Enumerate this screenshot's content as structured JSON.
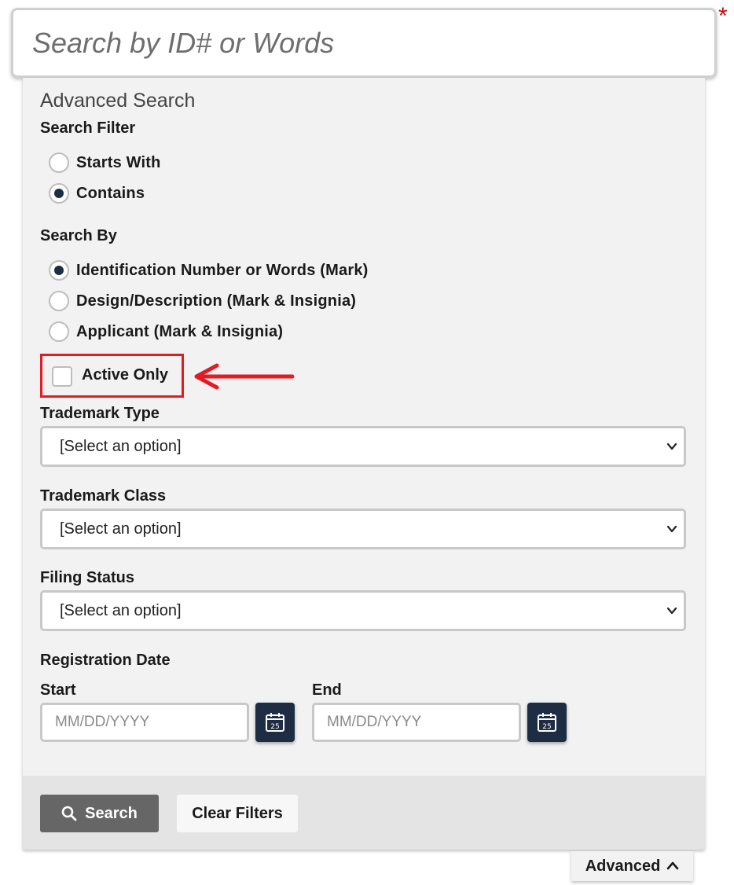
{
  "search": {
    "placeholder": "Search by ID# or Words",
    "required_marker": "*"
  },
  "advanced_title": "Advanced Search",
  "search_filter": {
    "label": "Search Filter",
    "options": [
      {
        "label": "Starts With",
        "checked": false
      },
      {
        "label": "Contains",
        "checked": true
      }
    ]
  },
  "search_by": {
    "label": "Search By",
    "options": [
      {
        "label": "Identification Number or Words (Mark)",
        "checked": true
      },
      {
        "label": "Design/Description (Mark & Insignia)",
        "checked": false
      },
      {
        "label": "Applicant (Mark & Insignia)",
        "checked": false
      }
    ]
  },
  "active_only": {
    "label": "Active Only",
    "checked": false
  },
  "trademark_type": {
    "label": "Trademark Type",
    "value": "[Select an option]"
  },
  "trademark_class": {
    "label": "Trademark Class",
    "value": "[Select an option]"
  },
  "filing_status": {
    "label": "Filing Status",
    "value": "[Select an option]"
  },
  "registration_date": {
    "label": "Registration Date",
    "start": {
      "label": "Start",
      "placeholder": "MM/DD/YYYY"
    },
    "end": {
      "label": "End",
      "placeholder": "MM/DD/YYYY"
    },
    "calendar_day": "25"
  },
  "buttons": {
    "search": "Search",
    "clear": "Clear Filters"
  },
  "advanced_toggle": "Advanced",
  "colors": {
    "accent": "#1e2d44",
    "highlight": "#e31b23",
    "required": "#d40000"
  },
  "icons": [
    "search-icon",
    "calendar-icon",
    "chevron-down-icon",
    "chevron-up-icon",
    "arrow-left-icon"
  ]
}
